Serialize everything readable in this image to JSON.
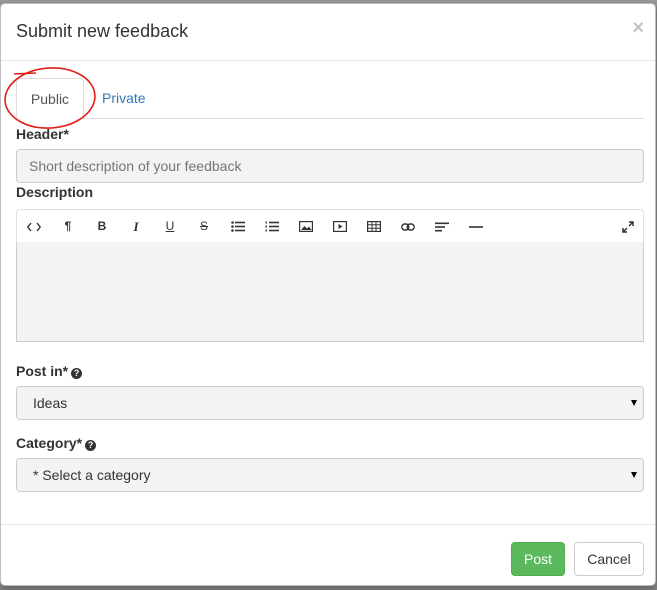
{
  "dialog": {
    "title": "Submit new feedback",
    "close_label": "×"
  },
  "tabs": [
    {
      "label": "Public",
      "active": true
    },
    {
      "label": "Private",
      "active": false
    }
  ],
  "header_field": {
    "label": "Header*",
    "placeholder": "Short description of your feedback",
    "value": ""
  },
  "description_field": {
    "label": "Description",
    "toolbar": [
      {
        "icon": "code-icon",
        "glyph": "<>"
      },
      {
        "icon": "paragraph-icon",
        "glyph": "¶"
      },
      {
        "icon": "bold-icon",
        "glyph": "B"
      },
      {
        "icon": "italic-icon",
        "glyph": "I"
      },
      {
        "icon": "underline-icon",
        "glyph": "U"
      },
      {
        "icon": "strikethrough-icon",
        "glyph": "S"
      },
      {
        "icon": "unordered-list-icon",
        "glyph": ""
      },
      {
        "icon": "ordered-list-icon",
        "glyph": ""
      },
      {
        "icon": "image-icon",
        "glyph": ""
      },
      {
        "icon": "video-icon",
        "glyph": ""
      },
      {
        "icon": "table-icon",
        "glyph": ""
      },
      {
        "icon": "link-icon",
        "glyph": ""
      },
      {
        "icon": "align-icon",
        "glyph": ""
      },
      {
        "icon": "horizontal-rule-icon",
        "glyph": ""
      },
      {
        "icon": "fullscreen-icon",
        "glyph": ""
      }
    ],
    "value": ""
  },
  "post_in_field": {
    "label": "Post in*",
    "selected": "Ideas"
  },
  "category_field": {
    "label": "Category*",
    "selected": "* Select a category"
  },
  "footer": {
    "post_label": "Post",
    "cancel_label": "Cancel"
  },
  "colors": {
    "primary_link": "#337ab7",
    "success": "#5cb85c",
    "annotation": "#e0201b"
  }
}
